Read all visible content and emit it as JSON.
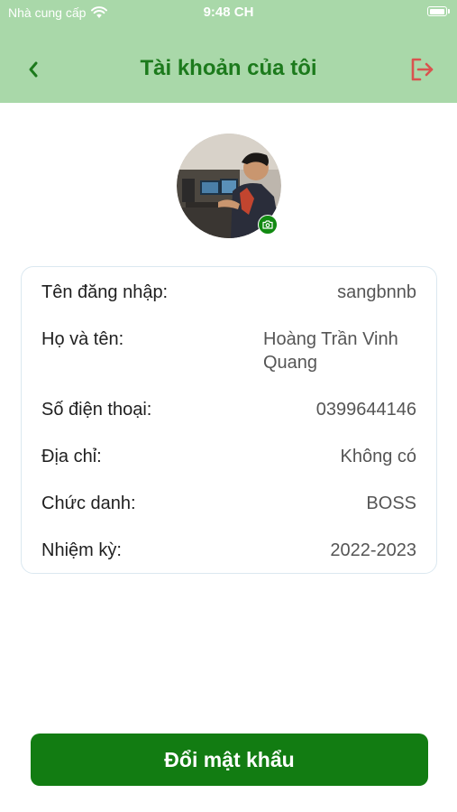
{
  "status_bar": {
    "carrier": "Nhà cung cấp",
    "time": "9:48 CH"
  },
  "nav": {
    "title": "Tài khoản của tôi",
    "back_icon": "chevron-left-icon",
    "logout_icon": "logout-icon"
  },
  "profile": {
    "avatar_icon": "avatar",
    "camera_icon": "camera-icon",
    "fields": [
      {
        "label": "Tên đăng nhập:",
        "value": "sangbnnb"
      },
      {
        "label": "Họ và tên:",
        "value": "Hoàng Trần Vinh Quang"
      },
      {
        "label": "Số điện thoại:",
        "value": "0399644146"
      },
      {
        "label": "Địa chỉ:",
        "value": "Không có"
      },
      {
        "label": "Chức danh:",
        "value": "BOSS"
      },
      {
        "label": "Nhiệm kỳ:",
        "value": "2022-2023"
      }
    ]
  },
  "actions": {
    "change_password_label": "Đổi mật khẩu"
  },
  "colors": {
    "header_bg": "#a9d8a9",
    "title_green": "#1c7a1c",
    "logout_red": "#d9534f",
    "button_green": "#127c12"
  }
}
